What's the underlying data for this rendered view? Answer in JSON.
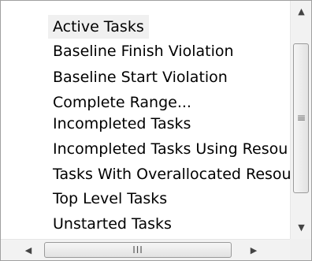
{
  "list": {
    "items": [
      {
        "label": "Active Tasks",
        "selected": true
      },
      {
        "label": "Baseline Finish Violation"
      },
      {
        "label": "Baseline Start Violation"
      },
      {
        "label": "Complete Range..."
      },
      {
        "label": "Incompleted Tasks"
      },
      {
        "label": "Incompleted Tasks Using Resou"
      },
      {
        "label": "Tasks With Overallocated Resou"
      },
      {
        "label": "Top Level Tasks"
      },
      {
        "label": "Unstarted Tasks"
      }
    ]
  },
  "icons": {
    "scroll_up": "▲",
    "scroll_down": "▼",
    "scroll_left": "◀",
    "scroll_right": "▶",
    "vgrip": "≡",
    "hgrip": "III"
  },
  "colors": {
    "selected_bg": "#f0f0f0",
    "border": "#a0a0a0",
    "scrollbar_track": "#f2f2f2"
  }
}
